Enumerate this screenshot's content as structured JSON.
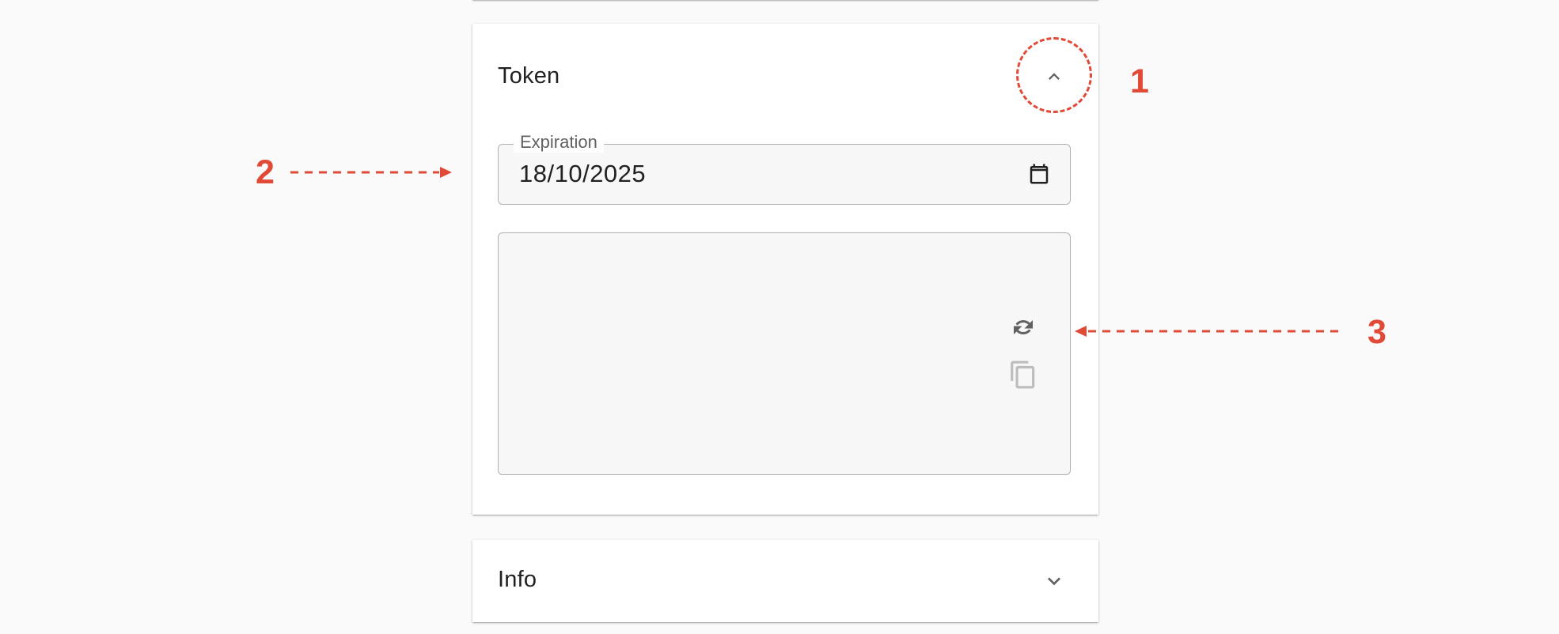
{
  "token_card": {
    "title": "Token",
    "expiration": {
      "label": "Expiration",
      "value": "18/10/2025"
    },
    "token_value": ""
  },
  "info_card": {
    "title": "Info"
  },
  "annotations": {
    "one": "1",
    "two": "2",
    "three": "3"
  },
  "colors": {
    "annotation": "#e04a36",
    "icon": "#616161",
    "icon_disabled": "#bdbdbd",
    "text": "#212121"
  },
  "icons": {
    "collapse": "chevron-up-icon",
    "expand": "chevron-down-icon",
    "calendar": "calendar-icon",
    "regenerate": "refresh-icon",
    "copy": "copy-icon"
  }
}
